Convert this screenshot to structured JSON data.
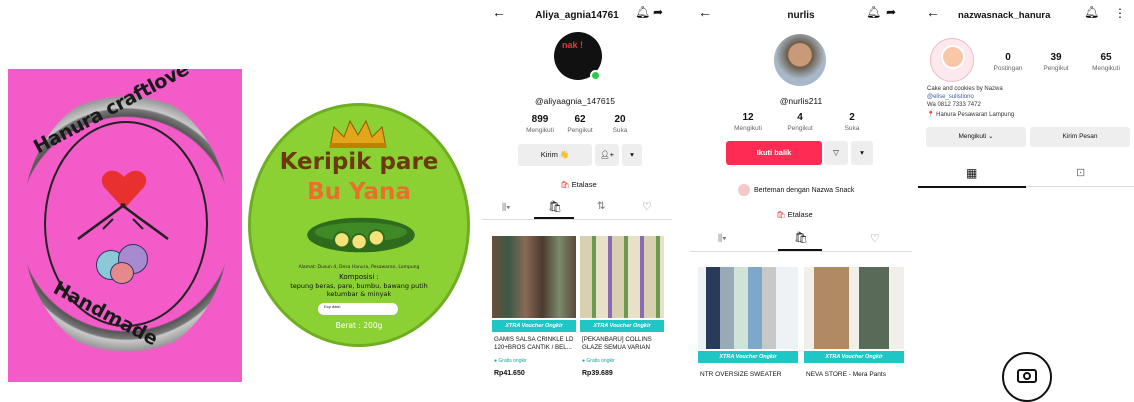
{
  "panel1": {
    "line1": "Hanura craftlove",
    "line2": "Handmade"
  },
  "panel2": {
    "title1": "Keripik pare",
    "title2": "Bu Yana",
    "address": "Alamat: Dusun 4, Desa Hanura, Pesawaran, Lampung",
    "komposisi_label": "Komposisi :",
    "komposisi": "tepung beras, pare, bumbu, bawang putih ketumbar & minyak",
    "exp_label": "Exp date:",
    "berat": "Berat : 200g"
  },
  "profile1": {
    "username": "Aliya_agnia14761",
    "handle": "@aliyaagnia_147615",
    "avatar_text": "nak !",
    "stats": [
      {
        "value": "899",
        "label": "Mengikuti"
      },
      {
        "value": "62",
        "label": "Pengikut"
      },
      {
        "value": "20",
        "label": "Suka"
      }
    ],
    "message_button": "Kirim 👋",
    "etalase": "Etalase",
    "products": [
      {
        "badge": "XTRA Voucher Ongkir",
        "title": "GAMIS SALSA CRINKLE LD 120+BROS CANTIK / BEL...",
        "ship": "● Gratis ongkir",
        "price": "Rp41.650"
      },
      {
        "badge": "XTRA Voucher Ongkir",
        "title": "[PEKANBARU] COLLINS GLAZE SEMUA VARIAN",
        "ship": "● Gratis ongkir",
        "price": "Rp39.689"
      }
    ]
  },
  "profile2": {
    "username": "nurlis",
    "handle": "@nurlis211",
    "stats": [
      {
        "value": "12",
        "label": "Mengikuti"
      },
      {
        "value": "4",
        "label": "Pengikut"
      },
      {
        "value": "2",
        "label": "Suka"
      }
    ],
    "follow_back": "Ikuti balik",
    "friends_text": "Berteman dengan Nazwa Snack",
    "etalase": "Etalase",
    "products": [
      {
        "badge": "XTRA Voucher Ongkir",
        "title": "NTR OVERSIZE SWEATER"
      },
      {
        "badge": "XTRA Voucher Ongkir",
        "title": "NEVA STORE - Mera Pants"
      }
    ]
  },
  "profile3": {
    "username": "nazwasnack_hanura",
    "stats": [
      {
        "value": "0",
        "label": "Postingan"
      },
      {
        "value": "39",
        "label": "Pengikut"
      },
      {
        "value": "65",
        "label": "Mengikuti"
      }
    ],
    "bio1": "Cake and cookies by Nazwa",
    "bio2": "@elise_sulistiono",
    "bio3": "Wa 0812 7333 7472",
    "bio4": "📍 Hanura Pesawaran Lampung",
    "following_button": "Mengikuti ⌄",
    "message_button": "Kirim Pesan"
  },
  "colors": {
    "pink": "#f35bc8",
    "green": "#8bd134",
    "tiktok_red": "#fe2c55",
    "xtra_teal": "#20c6c6"
  }
}
